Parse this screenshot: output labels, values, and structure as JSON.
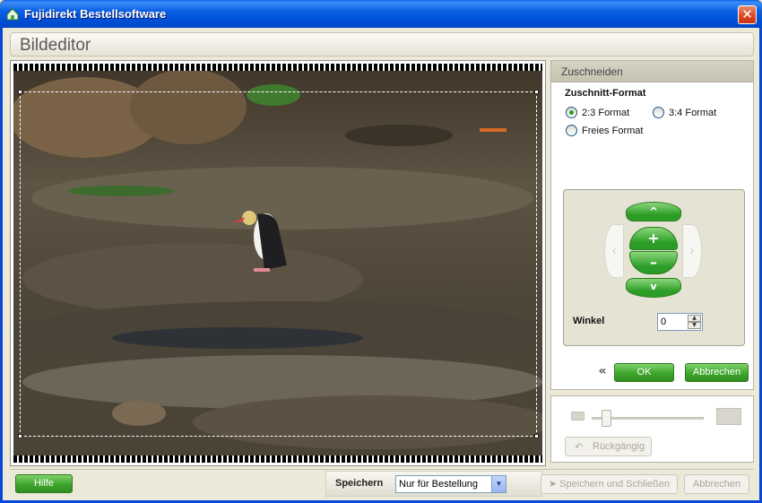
{
  "window": {
    "title": "Fujidirekt Bestellsoftware",
    "close_glyph": "✕"
  },
  "header": {
    "title": "Bildeditor"
  },
  "crop_panel": {
    "title": "Zuschneiden",
    "format_label": "Zuschnitt-Format",
    "options": [
      {
        "label": "2:3 Format",
        "selected": true
      },
      {
        "label": "3:4 Format",
        "selected": false
      },
      {
        "label": "Freies Format",
        "selected": false
      }
    ],
    "nav": {
      "up": "^",
      "plus": "+",
      "minus": "–",
      "down": "v",
      "left": "‹",
      "right": "›"
    },
    "winkel_label": "Winkel",
    "winkel_value": "0",
    "back_glyph": "«",
    "ok_label": "OK",
    "cancel_label": "Abbrechen"
  },
  "edit_panel": {
    "undo_label": "Rückgängig",
    "zoom_level": 0.09
  },
  "bottom": {
    "help_label": "Hilfe",
    "save_label": "Speichern",
    "save_option": "Nur für Bestellung",
    "save_close_label": "Speichern und Schließen",
    "cancel_label": "Abbrechen"
  },
  "colors": {
    "accent_green": "#3ea52c",
    "title_blue": "#0a5fe3"
  }
}
